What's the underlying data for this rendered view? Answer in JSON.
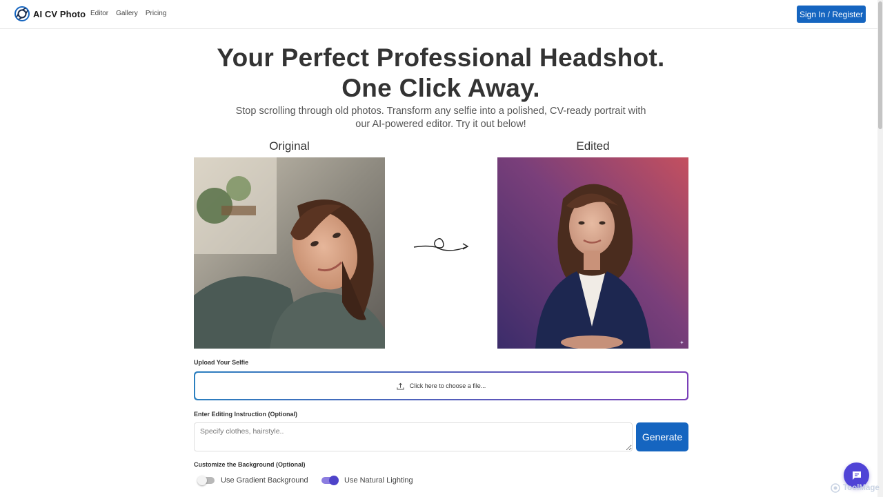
{
  "brand": {
    "name": "AI CV Photo",
    "logo_icon": "camera-aperture-icon"
  },
  "nav": {
    "links": [
      "Editor",
      "Gallery",
      "Pricing"
    ],
    "signin_label": "Sign In / Register"
  },
  "hero": {
    "title_line1": "Your Perfect Professional Headshot.",
    "title_line2": "One Click Away.",
    "subtitle": "Stop scrolling through old photos. Transform any selfie into a polished, CV-ready portrait with our AI-powered editor. Try it out below!"
  },
  "comparison": {
    "original_label": "Original",
    "edited_label": "Edited",
    "arrow_icon": "curly-arrow-right-icon",
    "sparkle_icon": "sparkle-icon"
  },
  "upload": {
    "label": "Upload Your Selfie",
    "prompt": "Click here to choose a file...",
    "icon": "upload-icon"
  },
  "instruction": {
    "label": "Enter Editing Instruction (Optional)",
    "placeholder": "Specify clothes, hairstyle..",
    "value": ""
  },
  "generate_label": "Generate",
  "background": {
    "label": "Customize the Background (Optional)",
    "toggles": [
      {
        "label": "Use Gradient Background",
        "on": false
      },
      {
        "label": "Use Natural Lighting",
        "on": true
      }
    ]
  },
  "chat": {
    "icon": "chat-icon"
  },
  "watermark": {
    "text": "ToolMage"
  },
  "colors": {
    "primary": "#1565c0",
    "accent": "#4f43d6",
    "upload_border_start": "#2b7fbf",
    "upload_border_end": "#7a3fb8"
  }
}
